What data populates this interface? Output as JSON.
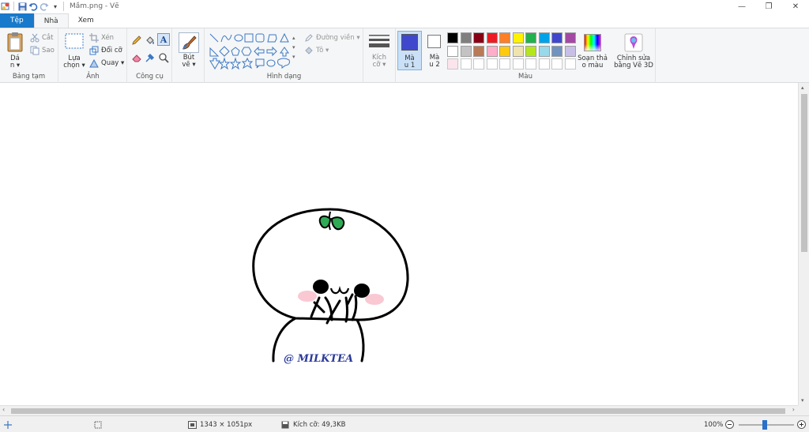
{
  "window": {
    "title": "Mầm.png - Vẽ",
    "minimize": "—",
    "maximize": "❐",
    "close": "✕"
  },
  "tabs": [
    "Tệp",
    "Nhà",
    "Xem"
  ],
  "ribbon": {
    "clipboard": {
      "label": "Bảng tạm",
      "paste": "Dá\nn ▾",
      "cut": "Cắt",
      "copy": "Sao"
    },
    "image": {
      "label": "Ảnh",
      "select": "Lựa\nchọn ▾",
      "crop": "Xén",
      "resize": "Đổi cỡ",
      "rotate": "Quay ▾"
    },
    "tools": {
      "label": "Công cụ"
    },
    "brushes": {
      "label": "Bút\nvẽ ▾"
    },
    "shapes": {
      "label": "Hình dạng",
      "outline": "Đường viền ▾",
      "fill": "Tô ▾"
    },
    "size": {
      "label": "Kích\ncỡ ▾"
    },
    "color1": {
      "label": "Mà\nu 1",
      "value": "#3f48cc"
    },
    "color2": {
      "label": "Mà\nu 2",
      "value": "#ffffff"
    },
    "colors": {
      "label": "Màu",
      "palette_row1": [
        "#000000",
        "#7f7f7f",
        "#880015",
        "#ed1c24",
        "#ff7f27",
        "#fff200",
        "#22b14c",
        "#00a2e8",
        "#3f48cc",
        "#a349a4"
      ],
      "palette_row2": [
        "#ffffff",
        "#c3c3c3",
        "#b97a57",
        "#ffaec9",
        "#ffc90e",
        "#efe4b0",
        "#b5e61d",
        "#99d9ea",
        "#7092be",
        "#c8bfe7"
      ],
      "palette_row3": [
        "#fce4ec",
        "#ffffff",
        "#ffffff",
        "#ffffff",
        "#ffffff",
        "#ffffff",
        "#ffffff",
        "#ffffff",
        "#ffffff",
        "#ffffff"
      ],
      "edit_colors": "Soạn thả\no màu",
      "paint3d": "Chỉnh sửa\nbằng Vẽ 3D"
    }
  },
  "canvas": {
    "watermark": "@ MILKTEA"
  },
  "statusbar": {
    "dimensions": "1343 × 1051px",
    "filesize": "Kích cỡ: 49,3KB",
    "zoom": "100%"
  }
}
